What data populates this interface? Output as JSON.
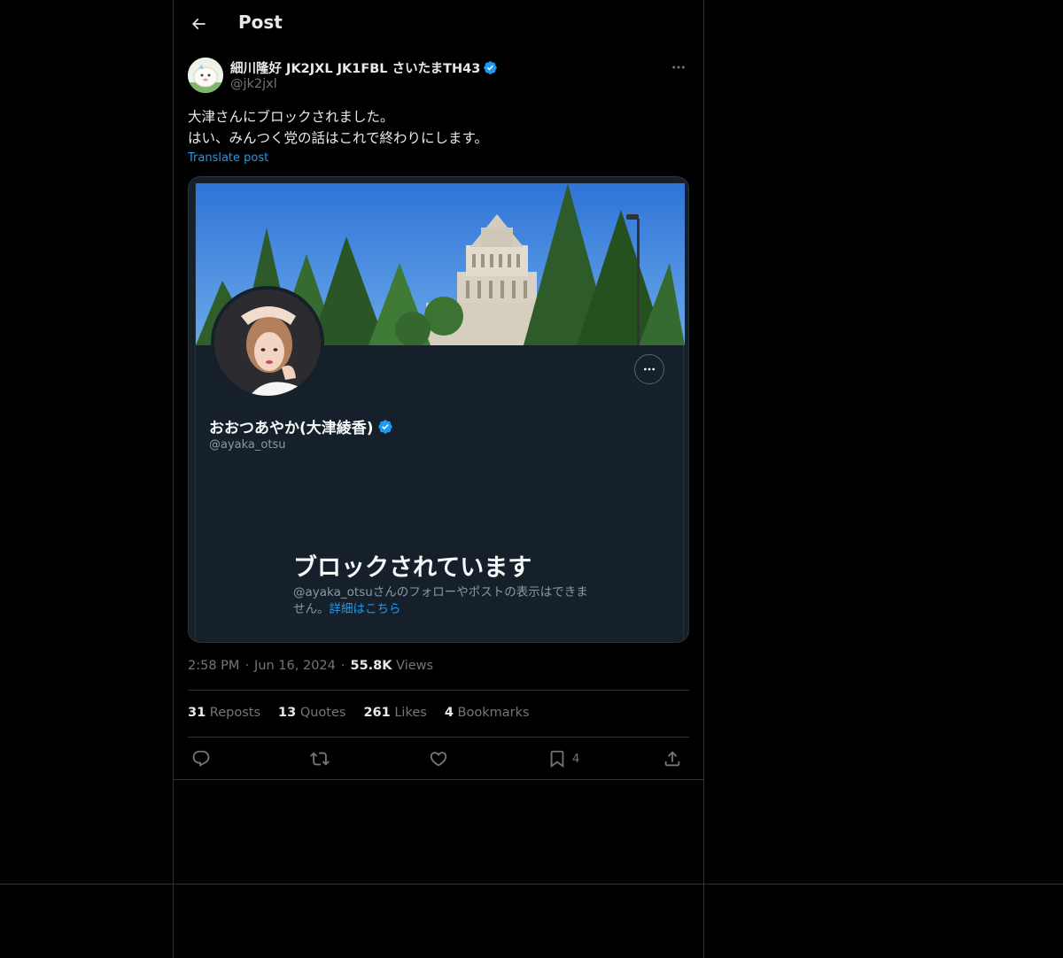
{
  "header": {
    "title": "Post"
  },
  "post": {
    "author_name": "細川隆好 JK2JXL JK1FBL さいたまTH43",
    "author_handle": "@jk2jxl",
    "text_line1": "大津さんにブロックされました。",
    "text_line2": "はい、みんつく党の話はこれで終わりにします。",
    "translate_label": "Translate post",
    "time": "2:58 PM",
    "dot1": "·",
    "date": "Jun 16, 2024",
    "dot2": "·",
    "views_count": "55.8K",
    "views_label": "Views"
  },
  "embedded_screenshot": {
    "profile_name": "おおつあやか(大津綾香)",
    "profile_handle": "@ayaka_otsu",
    "blocked_title": "ブロックされています",
    "blocked_desc": "@ayaka_otsuさんのフォローやポストの表示はできません。",
    "blocked_link": "詳細はこちら"
  },
  "stats": {
    "reposts_count": "31",
    "reposts_label": "Reposts",
    "quotes_count": "13",
    "quotes_label": "Quotes",
    "likes_count": "261",
    "likes_label": "Likes",
    "bookmarks_count": "4",
    "bookmarks_label": "Bookmarks"
  },
  "actions": {
    "bookmark_count": "4"
  },
  "icons": [
    "back-arrow-icon",
    "verified-badge-icon",
    "more-icon",
    "reply-icon",
    "repost-icon",
    "like-icon",
    "bookmark-icon",
    "share-icon"
  ],
  "colors": {
    "accent": "#1d9bf0",
    "background": "#000000",
    "text": "#e7e9ea",
    "muted": "#71767b",
    "border": "#2f3336"
  }
}
